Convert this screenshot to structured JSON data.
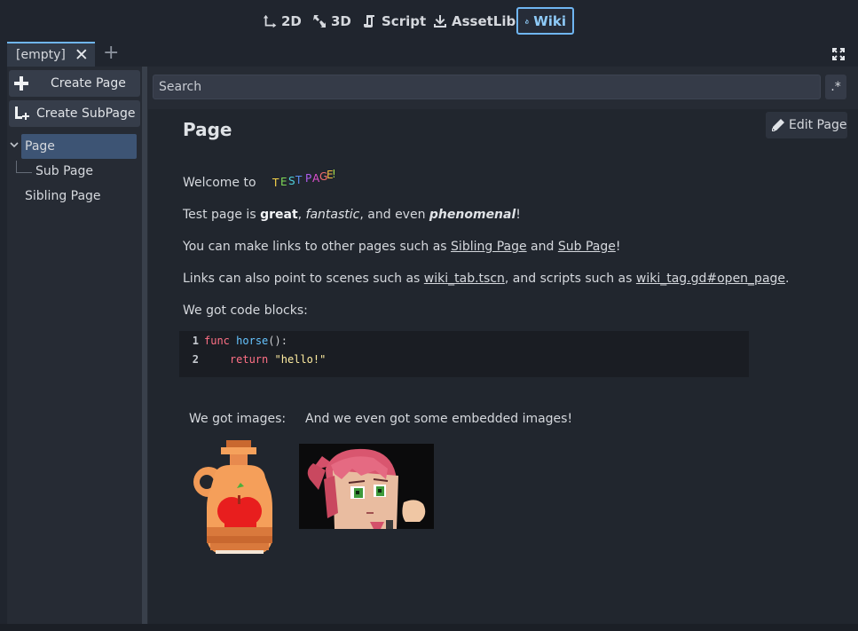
{
  "topbar": {
    "modes": [
      {
        "label": "2D",
        "icon": "2d-icon"
      },
      {
        "label": "3D",
        "icon": "3d-icon"
      },
      {
        "label": "Script",
        "icon": "script-icon"
      },
      {
        "label": "AssetLib",
        "icon": "assetlib-icon"
      },
      {
        "label": "Wiki",
        "icon": "wiki-icon",
        "active": true
      }
    ]
  },
  "tabs": {
    "items": [
      {
        "label": "[empty]",
        "close": "✕"
      }
    ],
    "add": "+"
  },
  "sidebar": {
    "create_page": "Create Page",
    "create_subpage": "Create SubPage",
    "tree": [
      {
        "label": "Page",
        "selected": true
      },
      {
        "label": "Sub Page"
      },
      {
        "label": "Sibling Page"
      }
    ]
  },
  "search": {
    "placeholder": "Search",
    "regex": ".*"
  },
  "content": {
    "edit_button": "Edit Page",
    "title": "Page",
    "welcome": "Welcome to",
    "rainbow_text": [
      "T",
      "E",
      "S",
      "T",
      " ",
      "P",
      "A",
      "G",
      "E",
      "!"
    ],
    "test_para": {
      "pre": "Test page is ",
      "bold": "great",
      "sep1": ", ",
      "italic": "fantastic",
      "sep2": ", and even ",
      "bold_italic": "phenomenal",
      "end": "!"
    },
    "links_para": {
      "pre": "You can make links to other pages such as ",
      "link1": "Sibling Page",
      "mid": " and ",
      "link2": "Sub Page",
      "end": "!"
    },
    "scenes_para": {
      "pre": "Links can also point to scenes such as ",
      "link1": "wiki_tab.tscn",
      "mid": ", and scripts such as ",
      "link2": "wiki_tag.gd#open_page",
      "end": "."
    },
    "code_intro": "We got code blocks:",
    "code": {
      "lines": [
        {
          "num": "1",
          "kw": "func",
          "fn": "horse",
          "rest": "():"
        },
        {
          "num": "2",
          "kw": "return",
          "str": "\"hello!\""
        }
      ]
    },
    "images_caption": "We got images:",
    "embedded_caption": "And we even got some embedded images!"
  },
  "colors": {
    "accent": "#6fb6f2",
    "selection": "#3d5474",
    "keyword": "#ff7085",
    "function": "#66c4ff",
    "string": "#ffeda1"
  }
}
